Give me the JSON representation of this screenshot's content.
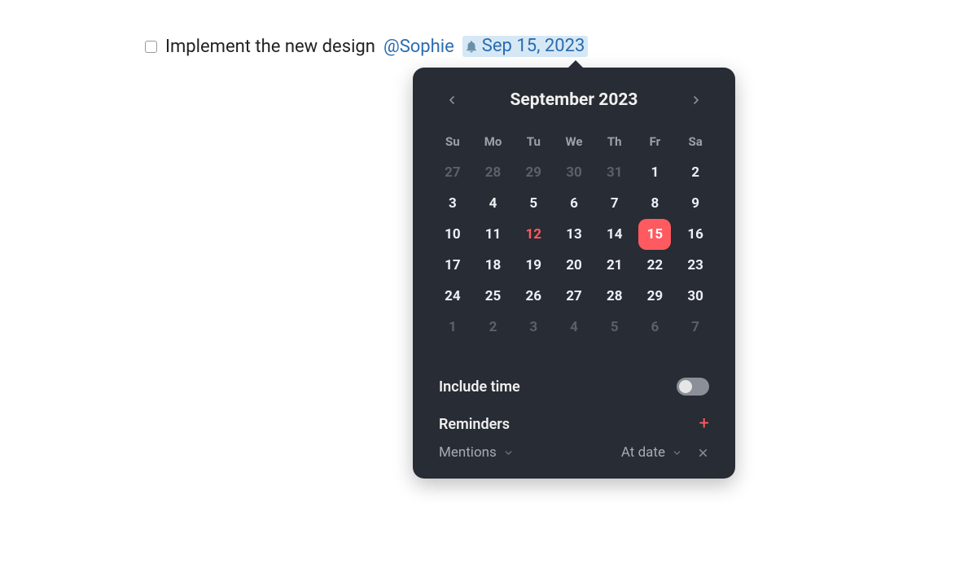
{
  "task": {
    "text": "Implement the new design",
    "mention": "@Sophie",
    "date_label": "Sep 15, 2023",
    "checked": false
  },
  "calendar": {
    "month_label": "September 2023",
    "weekdays": [
      "Su",
      "Mo",
      "Tu",
      "We",
      "Th",
      "Fr",
      "Sa"
    ],
    "weeks": [
      [
        {
          "n": "27",
          "outside": true
        },
        {
          "n": "28",
          "outside": true
        },
        {
          "n": "29",
          "outside": true
        },
        {
          "n": "30",
          "outside": true
        },
        {
          "n": "31",
          "outside": true
        },
        {
          "n": "1"
        },
        {
          "n": "2"
        }
      ],
      [
        {
          "n": "3"
        },
        {
          "n": "4"
        },
        {
          "n": "5"
        },
        {
          "n": "6"
        },
        {
          "n": "7"
        },
        {
          "n": "8"
        },
        {
          "n": "9"
        }
      ],
      [
        {
          "n": "10"
        },
        {
          "n": "11"
        },
        {
          "n": "12",
          "today": true
        },
        {
          "n": "13"
        },
        {
          "n": "14"
        },
        {
          "n": "15",
          "selected": true
        },
        {
          "n": "16"
        }
      ],
      [
        {
          "n": "17"
        },
        {
          "n": "18"
        },
        {
          "n": "19"
        },
        {
          "n": "20"
        },
        {
          "n": "21"
        },
        {
          "n": "22"
        },
        {
          "n": "23"
        }
      ],
      [
        {
          "n": "24"
        },
        {
          "n": "25"
        },
        {
          "n": "26"
        },
        {
          "n": "27"
        },
        {
          "n": "28"
        },
        {
          "n": "29"
        },
        {
          "n": "30"
        }
      ],
      [
        {
          "n": "1",
          "outside": true
        },
        {
          "n": "2",
          "outside": true
        },
        {
          "n": "3",
          "outside": true
        },
        {
          "n": "4",
          "outside": true
        },
        {
          "n": "5",
          "outside": true
        },
        {
          "n": "6",
          "outside": true
        },
        {
          "n": "7",
          "outside": true
        }
      ]
    ]
  },
  "options": {
    "include_time_label": "Include time",
    "include_time_on": false,
    "reminders_label": "Reminders",
    "add_label": "+",
    "reminder_type": "Mentions",
    "reminder_timing": "At date"
  },
  "colors": {
    "accent": "#ff5a5f",
    "panel": "#282c34",
    "link": "#2b6cb0",
    "chip_bg": "#d6e8f5"
  }
}
